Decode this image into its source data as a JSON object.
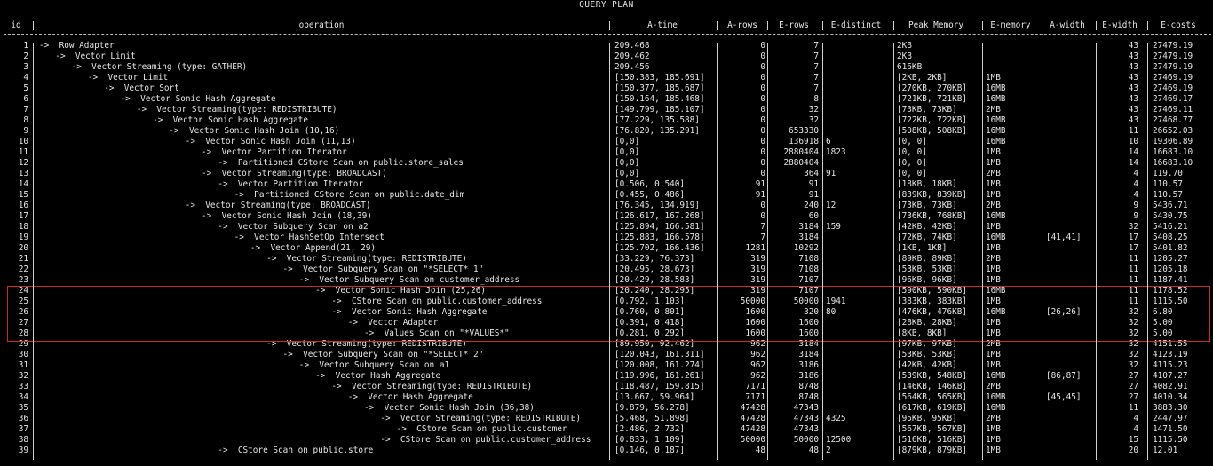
{
  "title": "QUERY PLAN",
  "headers": [
    "id",
    "operation",
    "A-time",
    "A-rows",
    "E-rows",
    "E-distinct",
    "Peak Memory",
    "E-memory",
    "A-width",
    "E-width",
    "E-costs"
  ],
  "highlight_color": "#c92a2a",
  "rows": [
    {
      "id": "1",
      "op": "->  Row Adapter",
      "indent": 0,
      "atime": "209.468",
      "arows": "0",
      "erows": "7",
      "edist": "",
      "peak": "2KB",
      "emem": "",
      "awidth": "",
      "ewidth": "43",
      "ecost": "27479.19"
    },
    {
      "id": "2",
      "op": "->  Vector Limit",
      "indent": 1,
      "atime": "209.462",
      "arows": "0",
      "erows": "7",
      "edist": "",
      "peak": "2KB",
      "emem": "",
      "awidth": "",
      "ewidth": "43",
      "ecost": "27479.19"
    },
    {
      "id": "3",
      "op": "->  Vector Streaming (type: GATHER)",
      "indent": 2,
      "atime": "209.456",
      "arows": "0",
      "erows": "7",
      "edist": "",
      "peak": "616KB",
      "emem": "",
      "awidth": "",
      "ewidth": "43",
      "ecost": "27479.19"
    },
    {
      "id": "4",
      "op": "->  Vector Limit",
      "indent": 3,
      "atime": "[150.383, 185.691]",
      "arows": "0",
      "erows": "7",
      "edist": "",
      "peak": "[2KB, 2KB]",
      "emem": "1MB",
      "awidth": "",
      "ewidth": "43",
      "ecost": "27469.19"
    },
    {
      "id": "5",
      "op": "->  Vector Sort",
      "indent": 4,
      "atime": "[150.377, 185.687]",
      "arows": "0",
      "erows": "7",
      "edist": "",
      "peak": "[270KB, 270KB]",
      "emem": "16MB",
      "awidth": "",
      "ewidth": "43",
      "ecost": "27469.19"
    },
    {
      "id": "6",
      "op": "->  Vector Sonic Hash Aggregate",
      "indent": 5,
      "atime": "[150.164, 185.468]",
      "arows": "0",
      "erows": "8",
      "edist": "",
      "peak": "[721KB, 721KB]",
      "emem": "16MB",
      "awidth": "",
      "ewidth": "43",
      "ecost": "27469.17"
    },
    {
      "id": "7",
      "op": "->  Vector Streaming(type: REDISTRIBUTE)",
      "indent": 6,
      "atime": "[149.799, 185.107]",
      "arows": "0",
      "erows": "32",
      "edist": "",
      "peak": "[73KB, 73KB]",
      "emem": "2MB",
      "awidth": "",
      "ewidth": "43",
      "ecost": "27469.11"
    },
    {
      "id": "8",
      "op": "->  Vector Sonic Hash Aggregate",
      "indent": 7,
      "atime": "[77.229, 135.588]",
      "arows": "0",
      "erows": "32",
      "edist": "",
      "peak": "[722KB, 722KB]",
      "emem": "16MB",
      "awidth": "",
      "ewidth": "43",
      "ecost": "27468.77"
    },
    {
      "id": "9",
      "op": "->  Vector Sonic Hash Join (10,16)",
      "indent": 8,
      "atime": "[76.820, 135.291]",
      "arows": "0",
      "erows": "653330",
      "edist": "",
      "peak": "[508KB, 508KB]",
      "emem": "16MB",
      "awidth": "",
      "ewidth": "11",
      "ecost": "26652.03"
    },
    {
      "id": "10",
      "op": "->  Vector Sonic Hash Join (11,13)",
      "indent": 9,
      "atime": "[0,0]",
      "arows": "0",
      "erows": "136918",
      "edist": "6",
      "peak": "[0, 0]",
      "emem": "16MB",
      "awidth": "",
      "ewidth": "10",
      "ecost": "19306.89"
    },
    {
      "id": "11",
      "op": "->  Vector Partition Iterator",
      "indent": 10,
      "atime": "[0,0]",
      "arows": "0",
      "erows": "2880404",
      "edist": "1823",
      "peak": "[0, 0]",
      "emem": "1MB",
      "awidth": "",
      "ewidth": "14",
      "ecost": "16683.10"
    },
    {
      "id": "12",
      "op": "->  Partitioned CStore Scan on public.store_sales",
      "indent": 11,
      "atime": "[0,0]",
      "arows": "0",
      "erows": "2880404",
      "edist": "",
      "peak": "[0, 0]",
      "emem": "1MB",
      "awidth": "",
      "ewidth": "14",
      "ecost": "16683.10"
    },
    {
      "id": "13",
      "op": "->  Vector Streaming(type: BROADCAST)",
      "indent": 10,
      "atime": "[0,0]",
      "arows": "0",
      "erows": "364",
      "edist": "91",
      "peak": "[0, 0]",
      "emem": "2MB",
      "awidth": "",
      "ewidth": "4",
      "ecost": "119.70"
    },
    {
      "id": "14",
      "op": "->  Vector Partition Iterator",
      "indent": 11,
      "atime": "[0.506, 0.540]",
      "arows": "91",
      "erows": "91",
      "edist": "",
      "peak": "[18KB, 18KB]",
      "emem": "1MB",
      "awidth": "",
      "ewidth": "4",
      "ecost": "110.57"
    },
    {
      "id": "15",
      "op": "->  Partitioned CStore Scan on public.date_dim",
      "indent": 12,
      "atime": "[0.455, 0.486]",
      "arows": "91",
      "erows": "91",
      "edist": "",
      "peak": "[839KB, 839KB]",
      "emem": "1MB",
      "awidth": "",
      "ewidth": "4",
      "ecost": "110.57"
    },
    {
      "id": "16",
      "op": "->  Vector Streaming(type: BROADCAST)",
      "indent": 9,
      "atime": "[76.345, 134.919]",
      "arows": "0",
      "erows": "240",
      "edist": "12",
      "peak": "[73KB, 73KB]",
      "emem": "2MB",
      "awidth": "",
      "ewidth": "9",
      "ecost": "5436.71"
    },
    {
      "id": "17",
      "op": "->  Vector Sonic Hash Join (18,39)",
      "indent": 10,
      "atime": "[126.617, 167.268]",
      "arows": "0",
      "erows": "60",
      "edist": "",
      "peak": "[736KB, 768KB]",
      "emem": "16MB",
      "awidth": "",
      "ewidth": "9",
      "ecost": "5430.75"
    },
    {
      "id": "18",
      "op": "->  Vector Subquery Scan on a2",
      "indent": 11,
      "atime": "[125.894, 166.581]",
      "arows": "7",
      "erows": "3184",
      "edist": "159",
      "peak": "[42KB, 42KB]",
      "emem": "1MB",
      "awidth": "",
      "ewidth": "32",
      "ecost": "5416.21"
    },
    {
      "id": "19",
      "op": "->  Vector HashSetOp Intersect",
      "indent": 12,
      "atime": "[125.883, 166.578]",
      "arows": "7",
      "erows": "3184",
      "edist": "",
      "peak": "[72KB, 74KB]",
      "emem": "16MB",
      "awidth": "[41,41]",
      "ewidth": "17",
      "ecost": "5408.25"
    },
    {
      "id": "20",
      "op": "->  Vector Append(21, 29)",
      "indent": 13,
      "atime": "[125.702, 166.436]",
      "arows": "1281",
      "erows": "10292",
      "edist": "",
      "peak": "[1KB, 1KB]",
      "emem": "1MB",
      "awidth": "",
      "ewidth": "17",
      "ecost": "5401.82"
    },
    {
      "id": "21",
      "op": "->  Vector Streaming(type: REDISTRIBUTE)",
      "indent": 14,
      "atime": "[33.229, 76.373]",
      "arows": "319",
      "erows": "7108",
      "edist": "",
      "peak": "[89KB, 89KB]",
      "emem": "2MB",
      "awidth": "",
      "ewidth": "11",
      "ecost": "1205.27"
    },
    {
      "id": "22",
      "op": "->  Vector Subquery Scan on \"*SELECT* 1\"",
      "indent": 15,
      "atime": "[20.495, 28.673]",
      "arows": "319",
      "erows": "7108",
      "edist": "",
      "peak": "[53KB, 53KB]",
      "emem": "1MB",
      "awidth": "",
      "ewidth": "11",
      "ecost": "1205.18"
    },
    {
      "id": "23",
      "op": "->  Vector Subquery Scan on customer_address",
      "indent": 16,
      "atime": "[20.429, 28.583]",
      "arows": "319",
      "erows": "7107",
      "edist": "",
      "peak": "[96KB, 96KB]",
      "emem": "1MB",
      "awidth": "",
      "ewidth": "11",
      "ecost": "1187.41"
    },
    {
      "id": "24",
      "op": "->  Vector Sonic Hash Join (25,26)",
      "indent": 17,
      "atime": "[20.240, 28.295]",
      "arows": "319",
      "erows": "7107",
      "edist": "",
      "peak": "[590KB, 590KB]",
      "emem": "16MB",
      "awidth": "",
      "ewidth": "11",
      "ecost": "1178.52"
    },
    {
      "id": "25",
      "op": "->  CStore Scan on public.customer_address",
      "indent": 18,
      "atime": "[0.792, 1.103]",
      "arows": "50000",
      "erows": "50000",
      "edist": "1941",
      "peak": "[383KB, 383KB]",
      "emem": "1MB",
      "awidth": "",
      "ewidth": "11",
      "ecost": "1115.50"
    },
    {
      "id": "26",
      "op": "->  Vector Sonic Hash Aggregate",
      "indent": 18,
      "atime": "[0.760, 0.801]",
      "arows": "1600",
      "erows": "320",
      "edist": "80",
      "peak": "[476KB, 476KB]",
      "emem": "16MB",
      "awidth": "[26,26]",
      "ewidth": "32",
      "ecost": "6.80"
    },
    {
      "id": "27",
      "op": "->  Vector Adapter",
      "indent": 19,
      "atime": "[0.391, 0.418]",
      "arows": "1600",
      "erows": "1600",
      "edist": "",
      "peak": "[28KB, 28KB]",
      "emem": "1MB",
      "awidth": "",
      "ewidth": "32",
      "ecost": "5.00"
    },
    {
      "id": "28",
      "op": "->  Values Scan on \"*VALUES*\"",
      "indent": 20,
      "atime": "[0.281, 0.292]",
      "arows": "1600",
      "erows": "1600",
      "edist": "",
      "peak": "[8KB, 8KB]",
      "emem": "1MB",
      "awidth": "",
      "ewidth": "32",
      "ecost": "5.00"
    },
    {
      "id": "29",
      "op": "->  Vector Streaming(type: REDISTRIBUTE)",
      "indent": 14,
      "atime": "[89.950, 92.462]",
      "arows": "962",
      "erows": "3184",
      "edist": "",
      "peak": "[97KB, 97KB]",
      "emem": "2MB",
      "awidth": "",
      "ewidth": "32",
      "ecost": "4151.55"
    },
    {
      "id": "30",
      "op": "->  Vector Subquery Scan on \"*SELECT* 2\"",
      "indent": 15,
      "atime": "[120.043, 161.311]",
      "arows": "962",
      "erows": "3184",
      "edist": "",
      "peak": "[53KB, 53KB]",
      "emem": "1MB",
      "awidth": "",
      "ewidth": "32",
      "ecost": "4123.19"
    },
    {
      "id": "31",
      "op": "->  Vector Subquery Scan on a1",
      "indent": 16,
      "atime": "[120.008, 161.274]",
      "arows": "962",
      "erows": "3186",
      "edist": "",
      "peak": "[42KB, 42KB]",
      "emem": "1MB",
      "awidth": "",
      "ewidth": "32",
      "ecost": "4115.23"
    },
    {
      "id": "32",
      "op": "->  Vector Hash Aggregate",
      "indent": 17,
      "atime": "[119.996, 161.261]",
      "arows": "962",
      "erows": "3186",
      "edist": "",
      "peak": "[539KB, 548KB]",
      "emem": "16MB",
      "awidth": "[86,87]",
      "ewidth": "27",
      "ecost": "4107.27"
    },
    {
      "id": "33",
      "op": "->  Vector Streaming(type: REDISTRIBUTE)",
      "indent": 18,
      "atime": "[118.487, 159.815]",
      "arows": "7171",
      "erows": "8748",
      "edist": "",
      "peak": "[146KB, 146KB]",
      "emem": "2MB",
      "awidth": "",
      "ewidth": "27",
      "ecost": "4082.91"
    },
    {
      "id": "34",
      "op": "->  Vector Hash Aggregate",
      "indent": 19,
      "atime": "[13.667, 59.964]",
      "arows": "7171",
      "erows": "8748",
      "edist": "",
      "peak": "[564KB, 565KB]",
      "emem": "16MB",
      "awidth": "[45,45]",
      "ewidth": "27",
      "ecost": "4010.34"
    },
    {
      "id": "35",
      "op": "->  Vector Sonic Hash Join (36,38)",
      "indent": 20,
      "atime": "[9.879, 56.278]",
      "arows": "47428",
      "erows": "47343",
      "edist": "",
      "peak": "[617KB, 619KB]",
      "emem": "16MB",
      "awidth": "",
      "ewidth": "11",
      "ecost": "3883.30"
    },
    {
      "id": "36",
      "op": "->  Vector Streaming(type: REDISTRIBUTE)",
      "indent": 21,
      "atime": "[5.468, 51.898]",
      "arows": "47428",
      "erows": "47343",
      "edist": "4325",
      "peak": "[95KB, 95KB]",
      "emem": "2MB",
      "awidth": "",
      "ewidth": "4",
      "ecost": "2447.97"
    },
    {
      "id": "37",
      "op": "->  CStore Scan on public.customer",
      "indent": 22,
      "atime": "[2.486, 2.732]",
      "arows": "47428",
      "erows": "47343",
      "edist": "",
      "peak": "[567KB, 567KB]",
      "emem": "1MB",
      "awidth": "",
      "ewidth": "4",
      "ecost": "1471.50"
    },
    {
      "id": "38",
      "op": "->  CStore Scan on public.customer_address",
      "indent": 21,
      "atime": "[0.833, 1.109]",
      "arows": "50000",
      "erows": "50000",
      "edist": "12500",
      "peak": "[516KB, 516KB]",
      "emem": "1MB",
      "awidth": "",
      "ewidth": "15",
      "ecost": "1115.50"
    },
    {
      "id": "39",
      "op": "->  CStore Scan on public.store",
      "indent": 11,
      "atime": "[0.146, 0.187]",
      "arows": "48",
      "erows": "48",
      "edist": "2",
      "peak": "[879KB, 879KB]",
      "emem": "1MB",
      "awidth": "",
      "ewidth": "20",
      "ecost": "12.01"
    }
  ]
}
